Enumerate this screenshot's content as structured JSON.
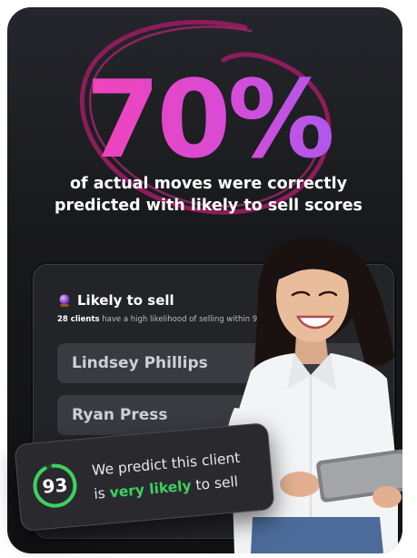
{
  "hero": {
    "stat": "70%",
    "line1": "of actual moves were correctly",
    "line2": "predicted with likely to sell scores"
  },
  "panel": {
    "title": "Likely to sell",
    "title_icon": "crystal-ball-icon",
    "sub_count": "28 clients",
    "sub_text": "have a high likelihood of selling within 9 months",
    "clients": [
      "Lindsey Phillips",
      "Ryan Press"
    ]
  },
  "toast": {
    "score": "93",
    "line1": "We predict this client",
    "line2_pre": "is",
    "line2_highlight": "very likely",
    "line2_post": "to sell",
    "score_fraction": 0.93
  },
  "colors": {
    "accent_pink": "#ff3ea8",
    "accent_purple": "#8d62ff",
    "circle_scribble": "#9b1f63",
    "score_green": "#3ed160",
    "card_bg": "#17181b"
  }
}
